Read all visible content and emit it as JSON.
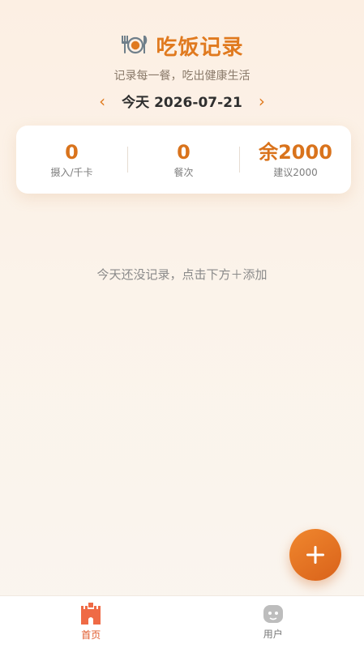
{
  "header": {
    "title": "吃饭记录",
    "subtitle": "记录每一餐，吃出健康生活",
    "icon": "plate-cutlery-icon"
  },
  "date_nav": {
    "prev_symbol": "‹",
    "date_text": "今天 2026-07-21",
    "next_symbol": "›"
  },
  "summary": [
    {
      "value": "0",
      "label": "摄入/千卡"
    },
    {
      "value": "0",
      "label": "餐次"
    },
    {
      "value": "余2000",
      "label": "建议2000"
    }
  ],
  "empty_message": "今天还没记录，点击下方＋添加",
  "fab": {
    "icon": "plus-icon"
  },
  "tabs": [
    {
      "label": "首页",
      "icon": "castle-icon",
      "active": true
    },
    {
      "label": "用户",
      "icon": "user-avatar-icon",
      "active": false
    }
  ],
  "colors": {
    "accent": "#e07a1f",
    "tab_active": "#e0582a",
    "background": "#fbf3ea"
  }
}
